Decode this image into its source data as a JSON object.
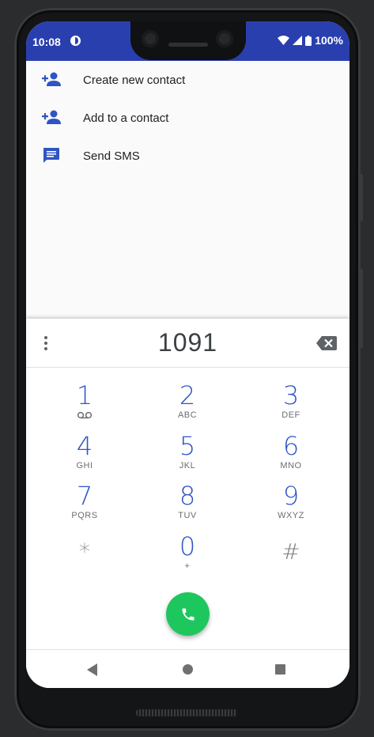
{
  "status_bar": {
    "time": "10:08",
    "battery": "100%"
  },
  "menu": {
    "items": [
      {
        "label": "Create new contact",
        "icon": "person-add-icon"
      },
      {
        "label": "Add to a contact",
        "icon": "person-add-icon"
      },
      {
        "label": "Send SMS",
        "icon": "message-icon"
      }
    ]
  },
  "dialpad": {
    "entered": "1091",
    "keys": [
      {
        "digit": "1",
        "letters": ""
      },
      {
        "digit": "2",
        "letters": "ABC"
      },
      {
        "digit": "3",
        "letters": "DEF"
      },
      {
        "digit": "4",
        "letters": "GHI"
      },
      {
        "digit": "5",
        "letters": "JKL"
      },
      {
        "digit": "6",
        "letters": "MNO"
      },
      {
        "digit": "7",
        "letters": "PQRS"
      },
      {
        "digit": "8",
        "letters": "TUV"
      },
      {
        "digit": "9",
        "letters": "WXYZ"
      },
      {
        "digit": "*",
        "letters": ""
      },
      {
        "digit": "0",
        "letters": "+"
      },
      {
        "digit": "#",
        "letters": ""
      }
    ]
  },
  "colors": {
    "status_bar": "#2a3fae",
    "accent": "#2f55c4",
    "call": "#1ec75e"
  }
}
